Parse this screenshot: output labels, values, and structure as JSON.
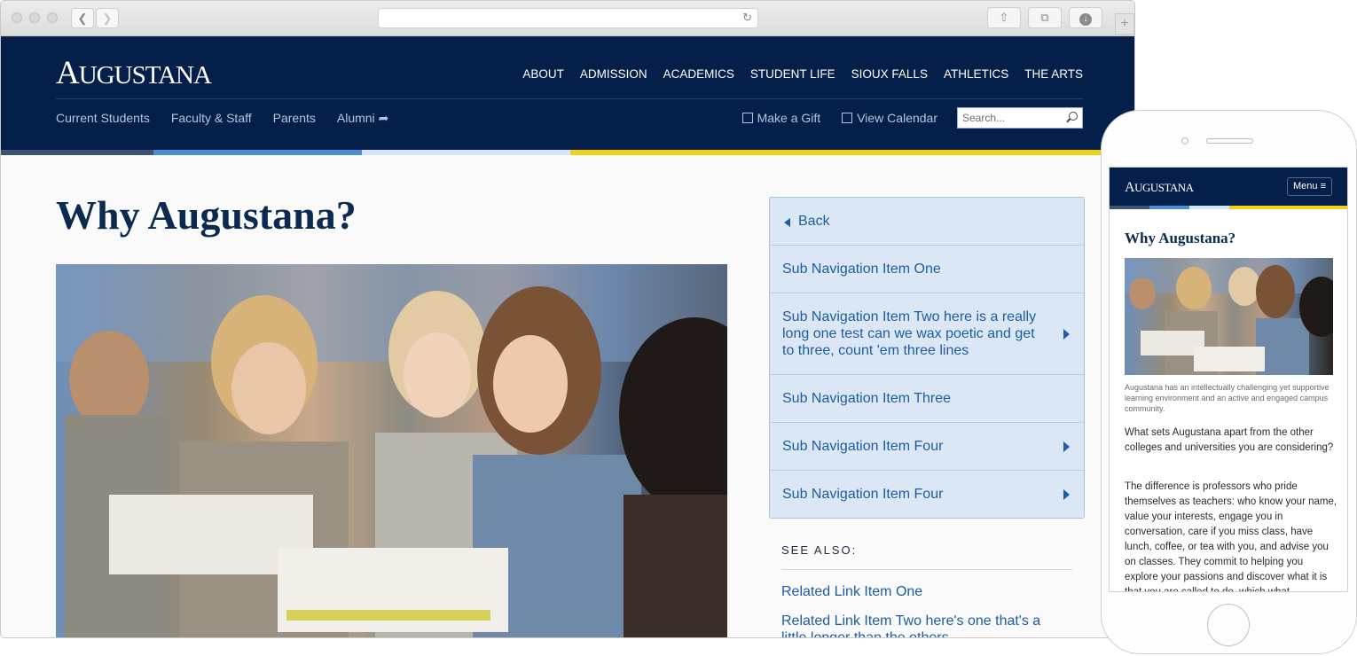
{
  "site": {
    "logo_big_a": "A",
    "logo_rest": "UGUSTANA",
    "main_nav": [
      "ABOUT",
      "ADMISSION",
      "ACADEMICS",
      "STUDENT LIFE",
      "SIOUX FALLS",
      "ATHLETICS",
      "THE ARTS"
    ],
    "utility_nav": [
      "Current Students",
      "Faculty & Staff",
      "Parents",
      "Alumni"
    ],
    "utility_right": {
      "gift": "Make a Gift",
      "calendar": "View Calendar"
    },
    "search_placeholder": "Search..."
  },
  "colors": {
    "navy": "#04204a",
    "bar": [
      "#3c5372",
      "#4a8fd6",
      "#d4e5f7",
      "#f2d216"
    ],
    "link": "#1c5da6",
    "subnav_bg": "#dbe7f5"
  },
  "page": {
    "title": "Why Augustana?",
    "photo_icon": "classroom-photo"
  },
  "subnav": {
    "back_label": "Back",
    "items": [
      {
        "label": "Sub Navigation Item One",
        "has_children": false
      },
      {
        "label": "Sub Navigation Item Two here is a really long one test can we wax poetic and get to three, count 'em three lines",
        "has_children": true
      },
      {
        "label": "Sub Navigation Item Three",
        "has_children": false
      },
      {
        "label": "Sub Navigation Item Four",
        "has_children": true
      },
      {
        "label": "Sub Navigation Item Four",
        "has_children": true
      }
    ]
  },
  "see_also": {
    "label": "SEE ALSO:",
    "links": [
      "Related Link Item One",
      "Related Link Item Two here's one that's a little longer than the others"
    ]
  },
  "mobile": {
    "logo_big_a": "A",
    "logo_rest": "UGUSTANA",
    "menu_label": "Menu ≡",
    "title": "Why Augustana?",
    "caption": "Augustana has an intellectually challenging yet supportive learning environment and an active and engaged campus community.",
    "paragraph_1": "What sets Augustana apart from the other colleges and universities you are considering?",
    "paragraph_2": "The difference is professors who pride themselves as teachers: who know your name, value your interests, engage you in conversation, care if you miss class, have lunch, coffee, or tea with you, and advise you on classes. They commit to helping you explore your passions and discover what it is that you are called to do, which what"
  }
}
